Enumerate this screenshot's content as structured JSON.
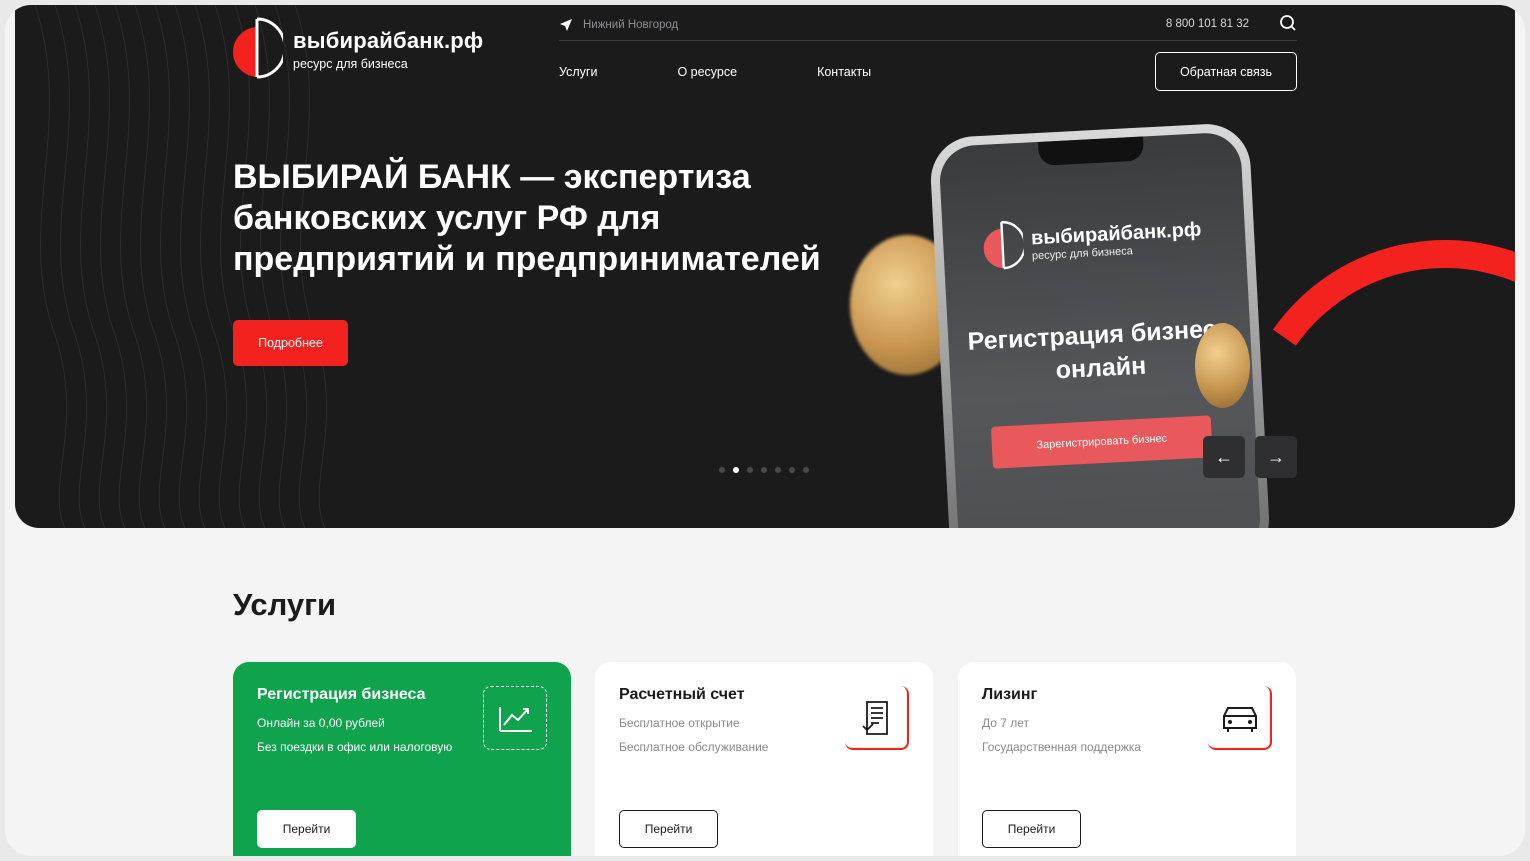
{
  "brand": {
    "name": "выбирайбанк.рф",
    "tagline": "ресурс для бизнеса",
    "accent": "#f3221f",
    "green": "#0ea34c"
  },
  "header": {
    "city": "Нижний Новгород",
    "phone": "8 800 101 81 32",
    "nav": [
      "Услуги",
      "О ресурсе",
      "Контакты"
    ],
    "feedback_label": "Обратная связь"
  },
  "hero": {
    "title": "ВЫБИРАЙ БАНК — экспертиза банковских услуг РФ для предприятий и предпринимателей",
    "cta_label": "Подробнее",
    "slide_count": 7,
    "active_slide": 2,
    "phone_screen": {
      "heading": "Регистрация бизнеса онлайн",
      "button_label": "Зарегистрировать бизнес"
    },
    "prev_arrow": "←",
    "next_arrow": "→"
  },
  "services": {
    "title": "Услуги",
    "cards": [
      {
        "title": "Регистрация бизнеса",
        "lines": [
          "Онлайн за 0,00 рублей",
          "Без поездки в офис или налоговую"
        ],
        "button": "Перейти",
        "icon": "chart-icon"
      },
      {
        "title": "Расчетный счет",
        "lines": [
          "Бесплатное открытие",
          "Бесплатное обслуживание"
        ],
        "button": "Перейти",
        "icon": "document-icon"
      },
      {
        "title": "Лизинг",
        "lines": [
          "До 7 лет",
          "Государственная поддержка"
        ],
        "button": "Перейти",
        "icon": "car-icon"
      }
    ]
  }
}
